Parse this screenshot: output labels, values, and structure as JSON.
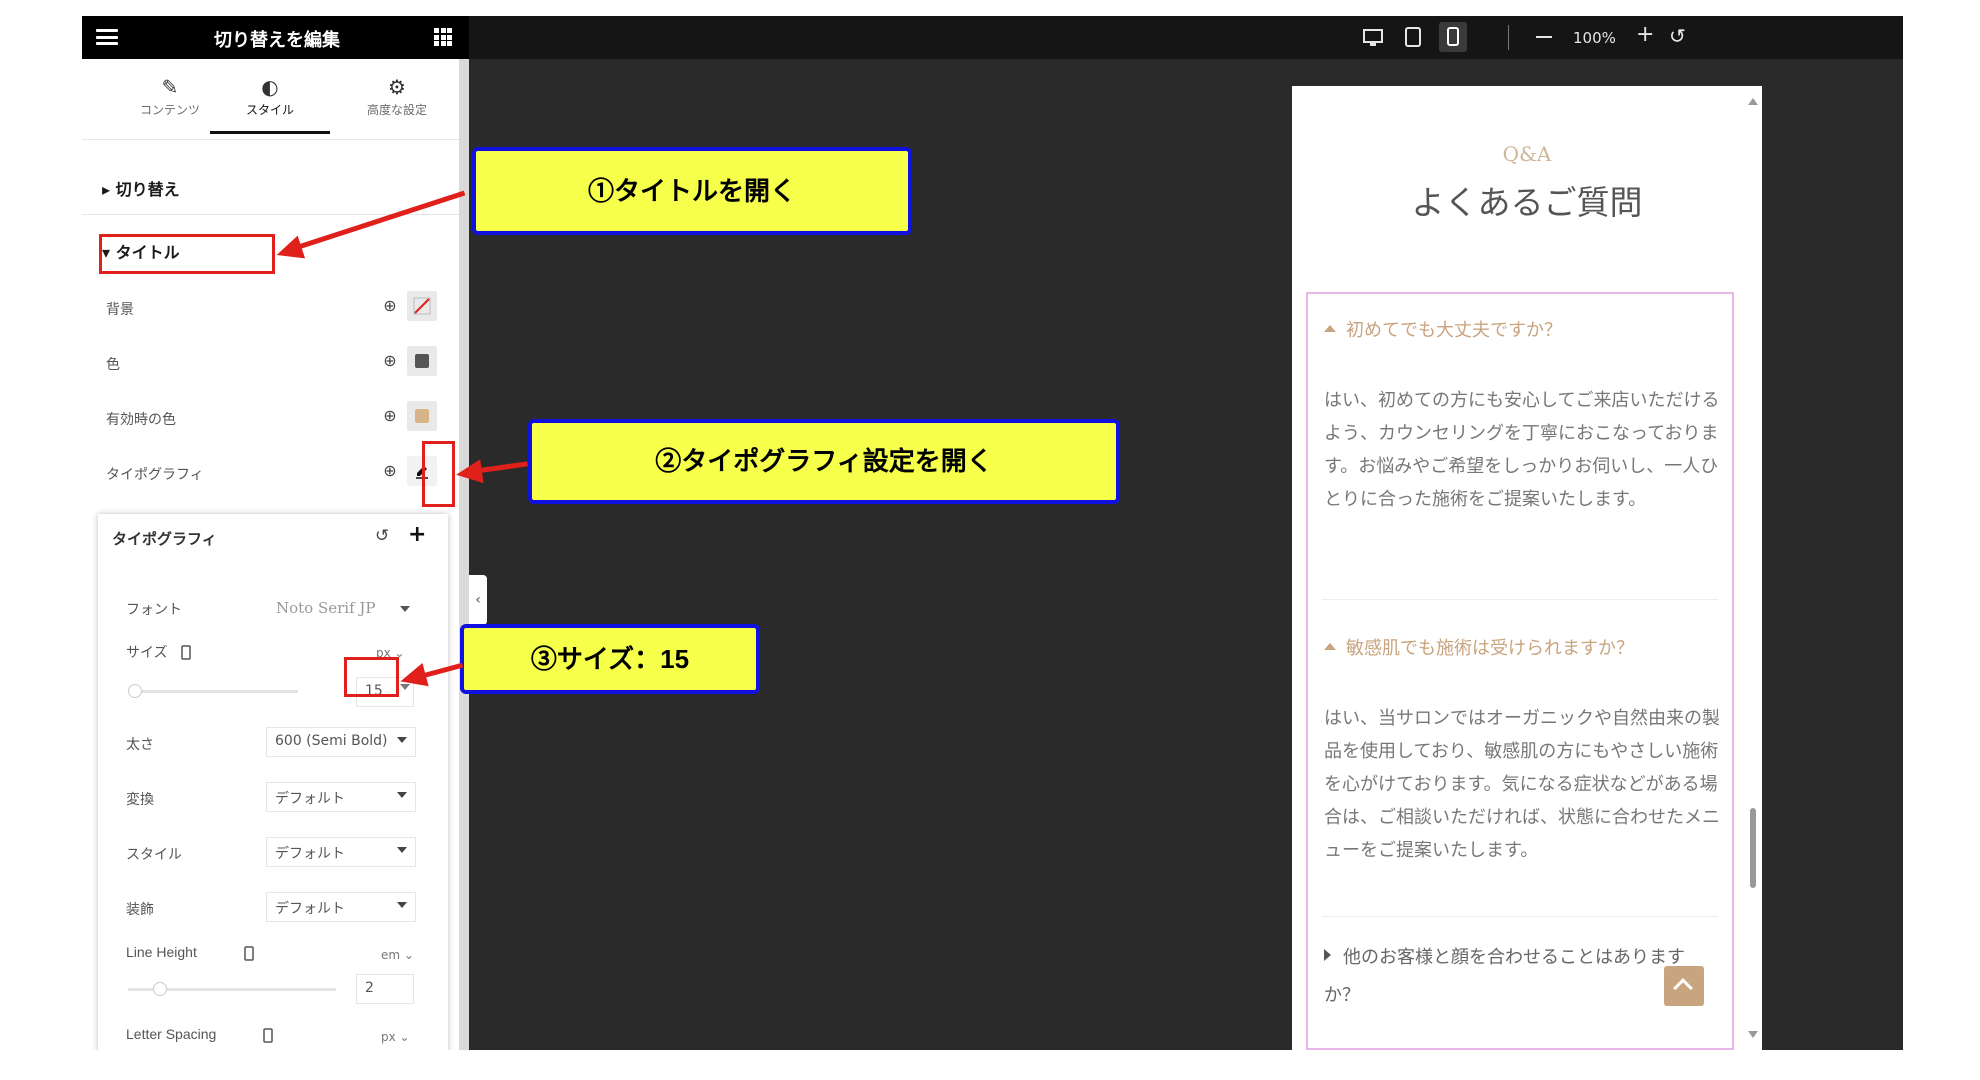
{
  "header": {
    "panel_title": "切り替えを編集",
    "zoom": "100%"
  },
  "tabs": [
    {
      "label": "コンテンツ",
      "icon": "pencil-icon"
    },
    {
      "label": "スタイル",
      "icon": "contrast-icon"
    },
    {
      "label": "高度な設定",
      "icon": "gear-icon"
    }
  ],
  "sections": {
    "toggle": "切り替え",
    "title": "タイトル"
  },
  "props": {
    "background": "背景",
    "color": "色",
    "active_color": "有効時の色",
    "typography": "タイポグラフィ"
  },
  "colors": {
    "color_swatch": "#555555",
    "active_color_swatch": "#d8b48a"
  },
  "typography_popover": {
    "title": "タイポグラフィ",
    "font_label": "フォント",
    "font_value": "Noto Serif JP",
    "size_label": "サイズ",
    "size_unit": "px",
    "size_value": "15",
    "weight_label": "太さ",
    "weight_value": "600 (Semi Bold)",
    "transform_label": "変換",
    "transform_value": "デフォルト",
    "style_label": "スタイル",
    "style_value": "デフォルト",
    "decoration_label": "装飾",
    "decoration_value": "デフォルト",
    "line_height_label": "Line Height",
    "line_height_unit": "em",
    "line_height_value": "2",
    "letter_spacing_label": "Letter Spacing",
    "letter_spacing_unit": "px"
  },
  "annotations": {
    "step1": "①タイトルを開く",
    "step2": "②タイポグラフィ設定を開く",
    "step3": "③サイズ：15"
  },
  "preview": {
    "eyebrow": "Q&A",
    "title": "よくあるご質問",
    "q1": "初めてでも大丈夫ですか？",
    "a1": "はい、初めての方にも安心してご来店いただけるよう、カウンセリングを丁寧におこなっております。お悩みやご希望をしっかりお伺いし、一人ひとりに合った施術をご提案いたします。",
    "q2": "敏感肌でも施術は受けられますか？",
    "a2": "はい、当サロンではオーガニックや自然由来の製品を使用しており、敏感肌の方にもやさしい施術を心がけております。気になる症状などがある場合は、ご相談いただければ、状態に合わせたメニューをご提案いたします。",
    "q3": "他のお客様と顔を合わせることはありますか？"
  }
}
